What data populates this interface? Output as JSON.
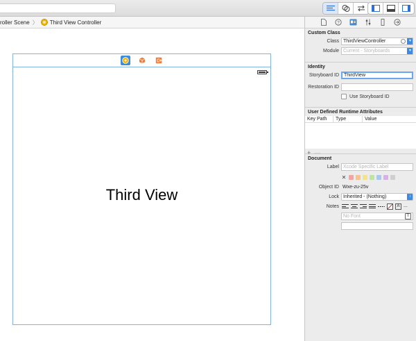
{
  "jumpbar": {
    "scene_crumb": "roller Scene",
    "controller_crumb": "Third View Controller",
    "separator": "〉"
  },
  "scene": {
    "label": "Third View"
  },
  "inspector": {
    "custom_class": {
      "title": "Custom Class",
      "class_label": "Class",
      "class_value": "ThirdViewController",
      "module_label": "Module",
      "module_placeholder": "Current - Storyboards"
    },
    "identity": {
      "title": "Identity",
      "storyboard_id_label": "Storyboard ID",
      "storyboard_id_value": "ThirdView",
      "restoration_id_label": "Restoration ID",
      "restoration_id_value": "",
      "use_storyboard_id_label": "Use Storyboard ID"
    },
    "runtime_attributes": {
      "title": "User Defined Runtime Attributes",
      "columns": [
        "Key Path",
        "Type",
        "Value"
      ],
      "add_glyph": "+",
      "remove_glyph": "—"
    },
    "document": {
      "title": "Document",
      "label_label": "Label",
      "label_placeholder": "Xcode Specific Label",
      "clear_glyph": "✕",
      "label_colors": [
        "#f5a3a3",
        "#f7c48f",
        "#f3e38a",
        "#bfe3a0",
        "#a9c8f0",
        "#d7b0ea",
        "#cfcfcf"
      ],
      "object_id_label": "Object ID",
      "object_id_value": "Wxe-zu-25v",
      "lock_label": "Lock",
      "lock_value": "Inherited - (Nothing)",
      "notes_label": "Notes",
      "font_placeholder": "No Font",
      "font_button": "T",
      "more_glyph": "..."
    }
  }
}
